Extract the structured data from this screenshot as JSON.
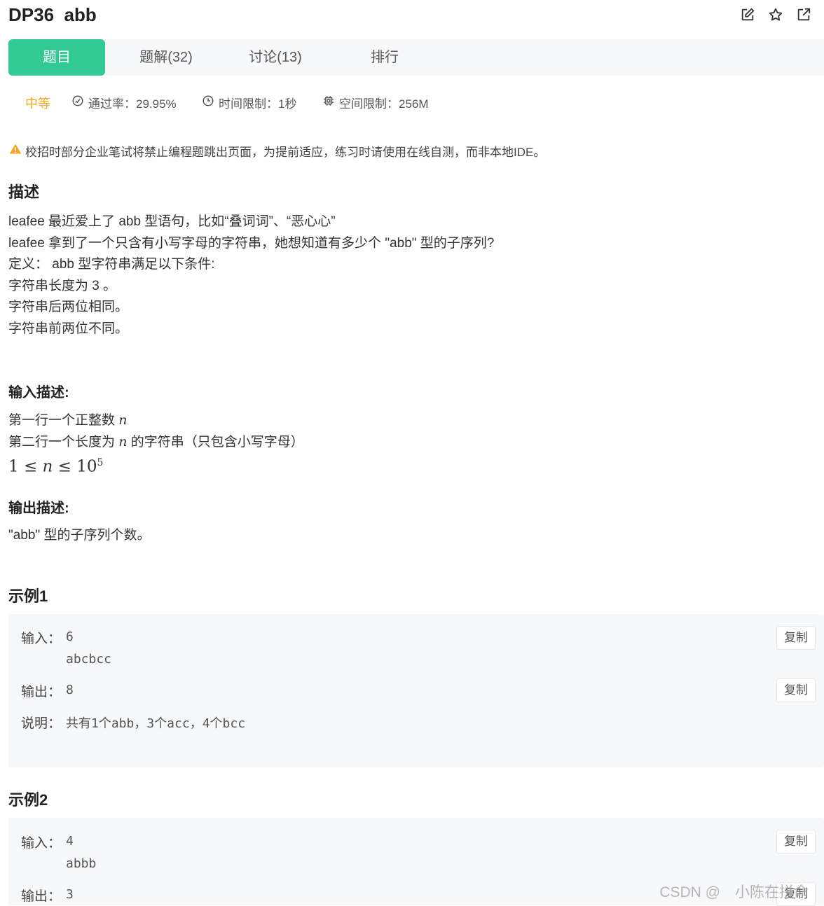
{
  "header": {
    "title": "DP36  abb",
    "icons": [
      "edit-icon",
      "star-icon",
      "external-link-icon"
    ]
  },
  "tabs": [
    {
      "label": "题目",
      "active": true
    },
    {
      "label": "题解(32)",
      "active": false
    },
    {
      "label": "讨论(13)",
      "active": false
    },
    {
      "label": "排行",
      "active": false
    }
  ],
  "meta": {
    "difficulty": "中等",
    "pass_rate": "通过率：29.95%",
    "time_limit": "时间限制：1秒",
    "space_limit": "空间限制：256M"
  },
  "notice": "校招时部分企业笔试将禁止编程题跳出页面，为提前适应，练习时请使用在线自测，而非本地IDE。",
  "description": {
    "heading": "描述",
    "lines": [
      "leafee 最近爱上了 abb 型语句，比如“叠词词”、“恶心心”",
      "leafee 拿到了一个只含有小写字母的字符串，她想知道有多少个 \"abb\" 型的子序列?",
      "定义： abb 型字符串满足以下条件:",
      "字符串长度为 3 。",
      "字符串后两位相同。",
      "字符串前两位不同。"
    ]
  },
  "input_desc": {
    "heading": "输入描述:",
    "line1_text": "第一行一个正整数 ",
    "line2_pre": "第二行一个长度为 ",
    "line2_post": " 的字符串（只包含小写字母）",
    "var_n": "n",
    "constraint_left": "1 ≤ ",
    "constraint_mid": " ≤ 10",
    "constraint_exp": "5"
  },
  "output_desc": {
    "heading": "输出描述:",
    "text": "\"abb\" 型的子序列个数。"
  },
  "examples": [
    {
      "heading": "示例1",
      "input_label": "输入：",
      "input_lines": [
        "6",
        "abcbcc"
      ],
      "output_label": "输出：",
      "output": "8",
      "explain_label": "说明：",
      "explain": "共有1个abb，3个acc，4个bcc",
      "copy_label": "复制"
    },
    {
      "heading": "示例2",
      "input_label": "输入：",
      "input_lines": [
        "4",
        "abbb"
      ],
      "output_label": "输出：",
      "output": "3",
      "copy_label": "复制"
    }
  ],
  "watermark": "CSDN @　小陈在拼命",
  "colors": {
    "accent": "#32c995",
    "difficulty": "#f5a623",
    "warning": "#f5a623"
  }
}
